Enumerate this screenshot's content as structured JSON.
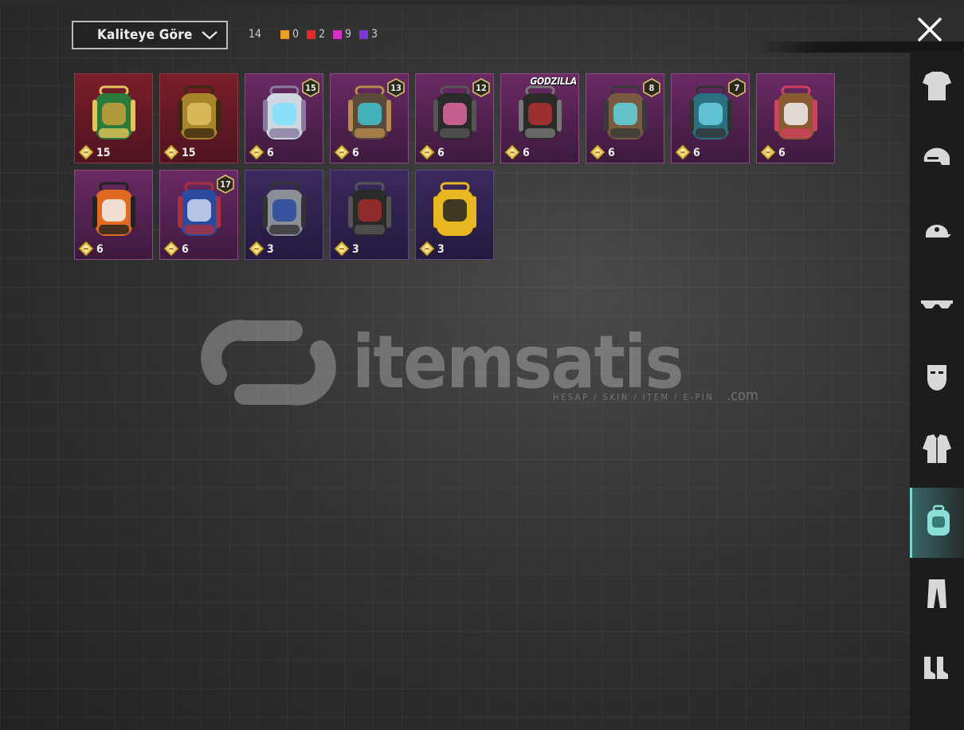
{
  "sort": {
    "label": "Kaliteye Göre"
  },
  "total_count": "14",
  "quality_counts": [
    {
      "color": "#e9a024",
      "value": "0"
    },
    {
      "color": "#e32a2a",
      "value": "2"
    },
    {
      "color": "#d62ec9",
      "value": "9"
    },
    {
      "color": "#7a38d8",
      "value": "3"
    }
  ],
  "items": [
    {
      "count": "15",
      "tier": "red",
      "icon": "ornate-green-backpack-icon"
    },
    {
      "count": "15",
      "tier": "red",
      "icon": "golden-pharaoh-backpack-icon"
    },
    {
      "count": "6",
      "tier": "pink",
      "level": "15",
      "icon": "white-tech-backpack-icon"
    },
    {
      "count": "6",
      "tier": "pink",
      "level": "13",
      "icon": "steampunk-backpack-icon"
    },
    {
      "count": "6",
      "tier": "pink",
      "level": "12",
      "icon": "pink-black-backpack-icon"
    },
    {
      "count": "6",
      "tier": "pink",
      "brand": "GODZILLA",
      "icon": "godzilla-backpack-icon"
    },
    {
      "count": "6",
      "tier": "pink",
      "level": "8",
      "icon": "octopus-backpack-icon"
    },
    {
      "count": "6",
      "tier": "pink",
      "level": "7",
      "icon": "teal-armor-backpack-icon"
    },
    {
      "count": "6",
      "tier": "pink",
      "icon": "fox-mask-backpack-icon"
    },
    {
      "count": "6",
      "tier": "pink",
      "icon": "skull-orange-backpack-icon"
    },
    {
      "count": "6",
      "tier": "pink",
      "level": "17",
      "icon": "blue-mask-backpack-icon"
    },
    {
      "count": "3",
      "tier": "purple",
      "icon": "silver-blue-backpack-icon"
    },
    {
      "count": "3",
      "tier": "purple",
      "icon": "red-black-backpack-icon"
    },
    {
      "count": "3",
      "tier": "purple",
      "icon": "yellow-smiley-backpack-icon"
    }
  ],
  "watermark": {
    "text": "itemsatis",
    "tagline": "HESAP / SKIN / ITEM / E-PIN",
    "suffix": ".com"
  },
  "categories": [
    {
      "name": "outfit-icon",
      "active": false
    },
    {
      "name": "helmet-icon",
      "active": false
    },
    {
      "name": "cap-icon",
      "active": false
    },
    {
      "name": "glasses-icon",
      "active": false
    },
    {
      "name": "mask-icon",
      "active": false
    },
    {
      "name": "jacket-icon",
      "active": false
    },
    {
      "name": "backpack-icon",
      "active": true
    },
    {
      "name": "pants-icon",
      "active": false
    },
    {
      "name": "shoes-icon",
      "active": false
    }
  ]
}
